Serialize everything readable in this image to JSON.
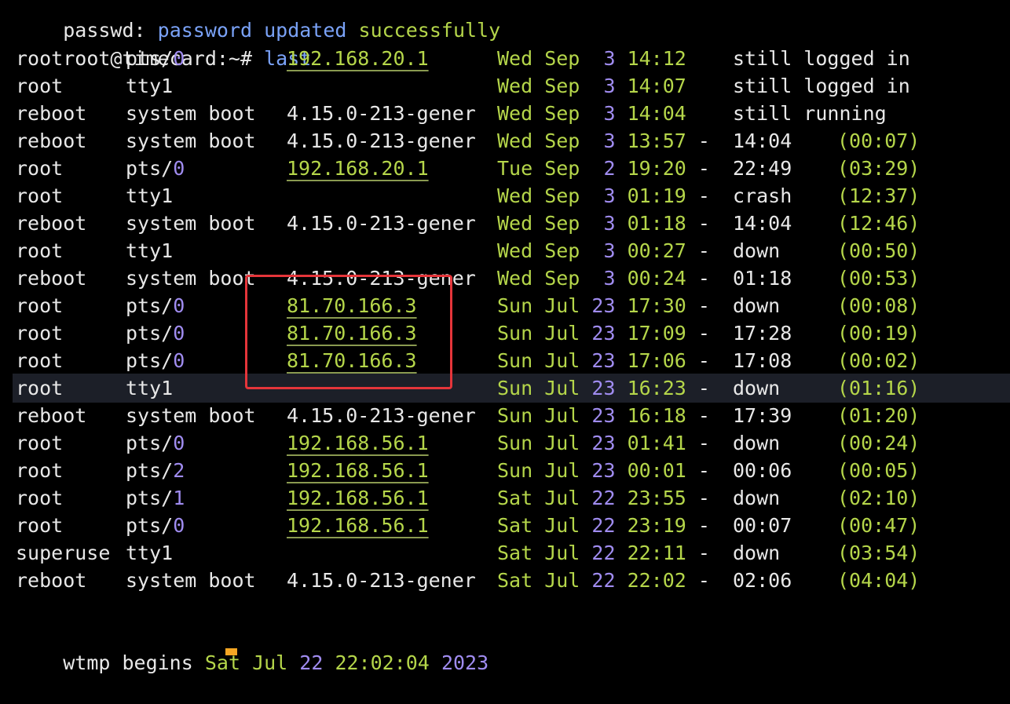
{
  "top_line": {
    "prefix": "passwd:",
    "message": "password updated",
    "status": "successfully"
  },
  "prompt": {
    "text": "root@timecard:~#",
    "command": "last"
  },
  "rows": [
    {
      "user": "root",
      "tty_a": "pts/",
      "tty_b": "0",
      "host": "192.168.20.1",
      "host_link": true,
      "date_a": "Wed Sep  ",
      "date_b": "3",
      "start": " 14:12",
      "sep": "  ",
      "end": "still logged in",
      "duration": ""
    },
    {
      "user": "root",
      "tty_a": "tty1",
      "tty_b": "",
      "host": "",
      "host_link": false,
      "date_a": "Wed Sep  ",
      "date_b": "3",
      "start": " 14:07",
      "sep": "  ",
      "end": "still logged in",
      "duration": ""
    },
    {
      "user": "reboot",
      "tty_a": "system boot",
      "tty_b": "",
      "host": "4.15.0-213-gener",
      "host_link": false,
      "date_a": "Wed Sep  ",
      "date_b": "3",
      "start": " 14:04",
      "sep": "  ",
      "end": "still running",
      "duration": ""
    },
    {
      "user": "reboot",
      "tty_a": "system boot",
      "tty_b": "",
      "host": "4.15.0-213-gener",
      "host_link": false,
      "date_a": "Wed Sep  ",
      "date_b": "3",
      "start": " 13:57",
      "sep": " - ",
      "end": "14:04",
      "duration": "(00:07)"
    },
    {
      "user": "root",
      "tty_a": "pts/",
      "tty_b": "0",
      "host": "192.168.20.1",
      "host_link": true,
      "date_a": "Tue Sep  ",
      "date_b": "2",
      "start": " 19:20",
      "sep": " - ",
      "end": "22:49",
      "duration": "(03:29)"
    },
    {
      "user": "root",
      "tty_a": "tty1",
      "tty_b": "",
      "host": "",
      "host_link": false,
      "date_a": "Wed Sep  ",
      "date_b": "3",
      "start": " 01:19",
      "sep": " - ",
      "end": "crash",
      "duration": "(12:37)"
    },
    {
      "user": "reboot",
      "tty_a": "system boot",
      "tty_b": "",
      "host": "4.15.0-213-gener",
      "host_link": false,
      "date_a": "Wed Sep  ",
      "date_b": "3",
      "start": " 01:18",
      "sep": " - ",
      "end": "14:04",
      "duration": "(12:46)"
    },
    {
      "user": "root",
      "tty_a": "tty1",
      "tty_b": "",
      "host": "",
      "host_link": false,
      "date_a": "Wed Sep  ",
      "date_b": "3",
      "start": " 00:27",
      "sep": " - ",
      "end": "down",
      "duration": "(00:50)"
    },
    {
      "user": "reboot",
      "tty_a": "system boot",
      "tty_b": "",
      "host": "4.15.0-213-gener",
      "host_link": false,
      "date_a": "Wed Sep  ",
      "date_b": "3",
      "start": " 00:24",
      "sep": " - ",
      "end": "01:18",
      "duration": "(00:53)"
    },
    {
      "user": "root",
      "tty_a": "pts/",
      "tty_b": "0",
      "host": "81.70.166.3",
      "host_link": true,
      "date_a": "Sun Jul ",
      "date_b": "23",
      "start": " 17:30",
      "sep": " - ",
      "end": "down",
      "duration": "(00:08)"
    },
    {
      "user": "root",
      "tty_a": "pts/",
      "tty_b": "0",
      "host": "81.70.166.3",
      "host_link": true,
      "date_a": "Sun Jul ",
      "date_b": "23",
      "start": " 17:09",
      "sep": " - ",
      "end": "17:28",
      "duration": "(00:19)"
    },
    {
      "user": "root",
      "tty_a": "pts/",
      "tty_b": "0",
      "host": "81.70.166.3",
      "host_link": true,
      "date_a": "Sun Jul ",
      "date_b": "23",
      "start": " 17:06",
      "sep": " - ",
      "end": "17:08",
      "duration": "(00:02)"
    },
    {
      "user": "root",
      "tty_a": "tty1",
      "tty_b": "",
      "host": "",
      "host_link": false,
      "date_a": "Sun Jul ",
      "date_b": "23",
      "start": " 16:23",
      "sep": " - ",
      "end": "down",
      "duration": "(01:16)"
    },
    {
      "user": "reboot",
      "tty_a": "system boot",
      "tty_b": "",
      "host": "4.15.0-213-gener",
      "host_link": false,
      "date_a": "Sun Jul ",
      "date_b": "23",
      "start": " 16:18",
      "sep": " - ",
      "end": "17:39",
      "duration": "(01:20)"
    },
    {
      "user": "root",
      "tty_a": "pts/",
      "tty_b": "0",
      "host": "192.168.56.1",
      "host_link": true,
      "date_a": "Sun Jul ",
      "date_b": "23",
      "start": " 01:41",
      "sep": " - ",
      "end": "down",
      "duration": "(00:24)"
    },
    {
      "user": "root",
      "tty_a": "pts/",
      "tty_b": "2",
      "host": "192.168.56.1",
      "host_link": true,
      "date_a": "Sun Jul ",
      "date_b": "23",
      "start": " 00:01",
      "sep": " - ",
      "end": "00:06",
      "duration": "(00:05)"
    },
    {
      "user": "root",
      "tty_a": "pts/",
      "tty_b": "1",
      "host": "192.168.56.1",
      "host_link": true,
      "date_a": "Sat Jul ",
      "date_b": "22",
      "start": " 23:55",
      "sep": " - ",
      "end": "down",
      "duration": "(02:10)"
    },
    {
      "user": "root",
      "tty_a": "pts/",
      "tty_b": "0",
      "host": "192.168.56.1",
      "host_link": true,
      "date_a": "Sat Jul ",
      "date_b": "22",
      "start": " 23:19",
      "sep": " - ",
      "end": "00:07",
      "duration": "(00:47)"
    },
    {
      "user": "superuse",
      "tty_a": "tty1",
      "tty_b": "",
      "host": "",
      "host_link": false,
      "date_a": "Sat Jul ",
      "date_b": "22",
      "start": " 22:11",
      "sep": " - ",
      "end": "down",
      "duration": "(03:54)"
    },
    {
      "user": "reboot",
      "tty_a": "system boot",
      "tty_b": "",
      "host": "4.15.0-213-gener",
      "host_link": false,
      "date_a": "Sat Jul ",
      "date_b": "22",
      "start": " 22:02",
      "sep": " - ",
      "end": "02:06",
      "duration": "(04:04)"
    }
  ],
  "footer": {
    "label": "wtmp begins",
    "day_mon": "Sat Jul",
    "day": "22",
    "time": "22:02:04",
    "year": "2023"
  },
  "colors": {
    "background": "#000000",
    "green": "#b5d64a",
    "blue": "#7aa2f7",
    "purple": "#a08cf0",
    "annotation": "#e5353a",
    "cursor": "#f5a623"
  }
}
